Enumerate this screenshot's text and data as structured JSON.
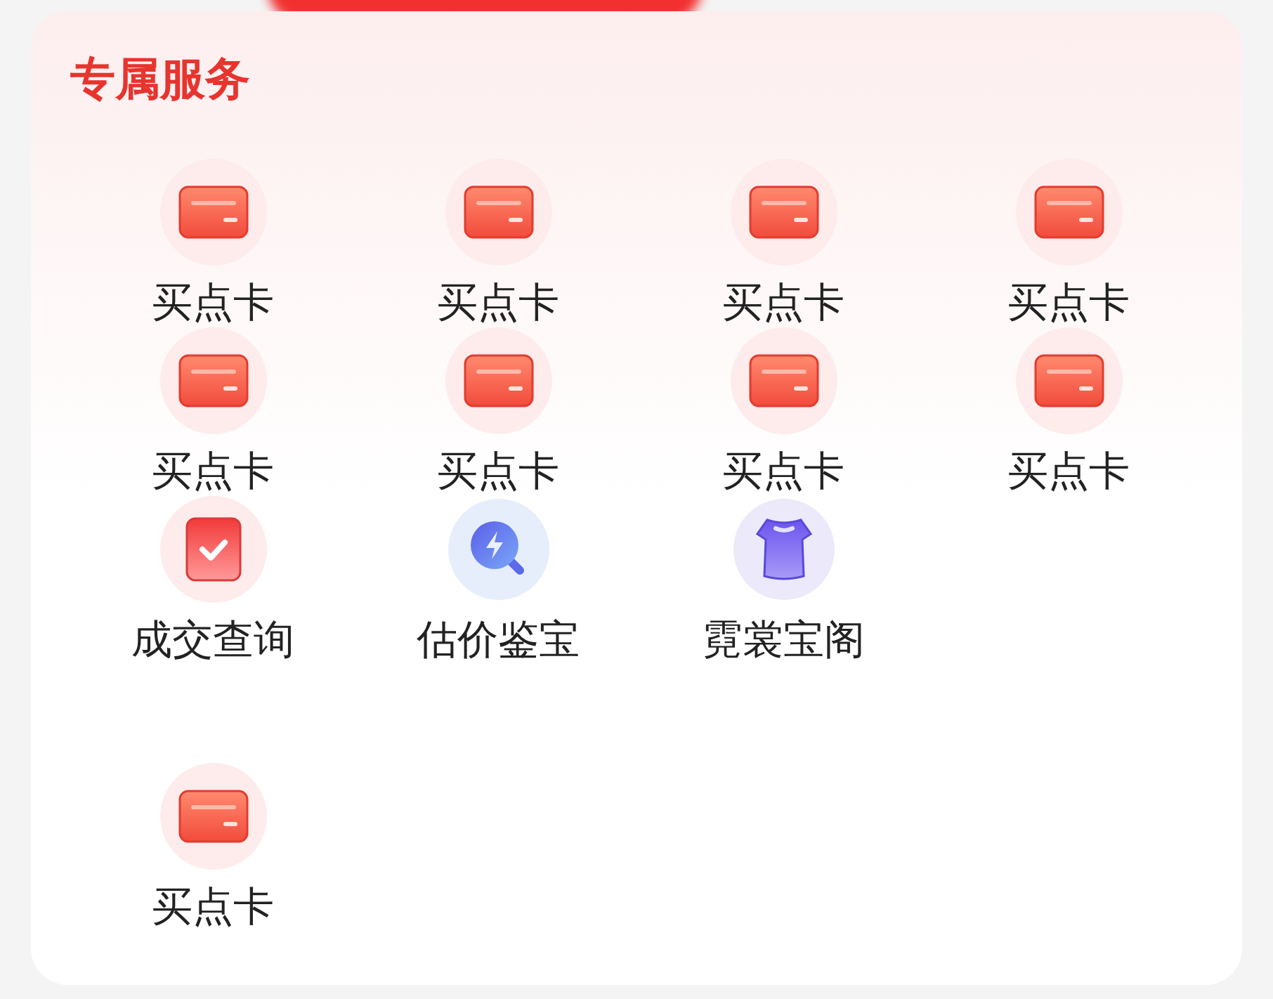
{
  "section": {
    "title": "专属服务"
  },
  "rows": [
    [
      {
        "kind": "card",
        "label": "买点卡"
      },
      {
        "kind": "card",
        "label": "买点卡"
      },
      {
        "kind": "card",
        "label": "买点卡"
      },
      {
        "kind": "card",
        "label": "买点卡"
      }
    ],
    [
      {
        "kind": "card",
        "label": "买点卡"
      },
      {
        "kind": "card",
        "label": "买点卡"
      },
      {
        "kind": "card",
        "label": "买点卡"
      },
      {
        "kind": "card",
        "label": "买点卡"
      }
    ],
    [
      {
        "kind": "check",
        "label": "成交查询"
      },
      {
        "kind": "search",
        "label": "估价鉴宝"
      },
      {
        "kind": "shirt",
        "label": "霓裳宝阁"
      }
    ],
    [
      {
        "kind": "card",
        "label": "买点卡"
      }
    ]
  ]
}
